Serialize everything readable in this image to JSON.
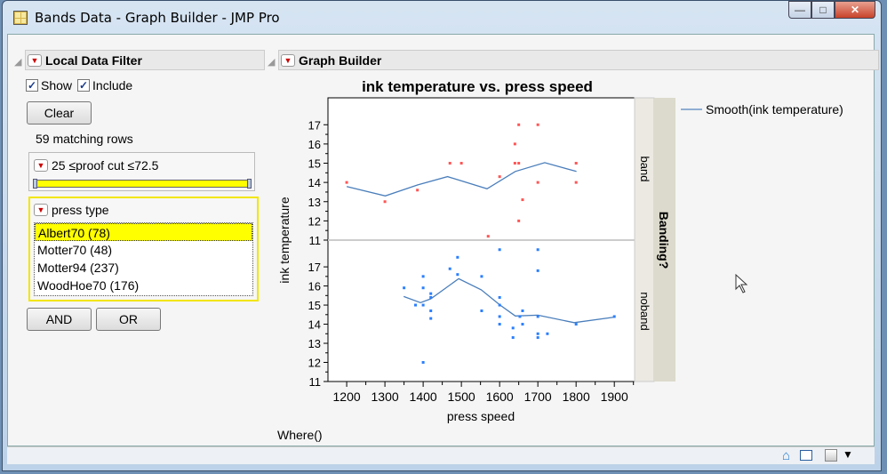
{
  "window": {
    "title": "Bands Data - Graph Builder - JMP Pro",
    "minimize": "—",
    "maximize": "□",
    "close": "✕"
  },
  "filter": {
    "header": "Local Data Filter",
    "show_label": "Show",
    "include_label": "Include",
    "show_checked": true,
    "include_checked": true,
    "clear": "Clear",
    "matching": "59 matching rows",
    "range": {
      "label": "25 ≤proof cut ≤72.5",
      "min": 25,
      "max": 72.5
    },
    "category": {
      "label": "press type",
      "items": [
        "Albert70 (78)",
        "Motter70 (48)",
        "Motter94 (237)",
        "WoodHoe70 (176)"
      ],
      "selected": "Albert70 (78)"
    },
    "and": "AND",
    "or": "OR",
    "highlight": "#ffff00"
  },
  "graph": {
    "header": "Graph Builder",
    "where": "Where()"
  },
  "chart_data": {
    "type": "scatter",
    "title": "ink temperature vs. press speed",
    "xlabel": "press speed",
    "ylabel": "ink temperature",
    "group_label": "Banding?",
    "xlim": [
      1151,
      1953
    ],
    "ylim": [
      11,
      18.4
    ],
    "xticks": [
      1200,
      1300,
      1400,
      1500,
      1600,
      1700,
      1800,
      1900
    ],
    "yticks": [
      11,
      12,
      13,
      14,
      15,
      16,
      17
    ],
    "legend": {
      "label": "Smooth(ink temperature)",
      "position": "top-right"
    },
    "line_color": "#4a7ebb",
    "panels": [
      {
        "name": "band",
        "color": "#ff5555",
        "points": [
          [
            1200,
            14
          ],
          [
            1300,
            13
          ],
          [
            1385,
            13.6
          ],
          [
            1470,
            15
          ],
          [
            1500,
            15
          ],
          [
            1570,
            11.2
          ],
          [
            1600,
            14.3
          ],
          [
            1640,
            16
          ],
          [
            1640,
            15
          ],
          [
            1650,
            15
          ],
          [
            1650,
            17
          ],
          [
            1660,
            13.1
          ],
          [
            1650,
            12
          ],
          [
            1700,
            17
          ],
          [
            1700,
            14
          ],
          [
            1800,
            15
          ],
          [
            1800,
            14
          ]
        ],
        "smooth": [
          [
            1200,
            13.79
          ],
          [
            1301,
            13.3
          ],
          [
            1386,
            13.87
          ],
          [
            1464,
            14.3
          ],
          [
            1567,
            13.67
          ],
          [
            1641,
            14.57
          ],
          [
            1718,
            15.03
          ],
          [
            1801,
            14.57
          ]
        ]
      },
      {
        "name": "noband",
        "color": "#2a7fff",
        "points": [
          [
            1350,
            15.9
          ],
          [
            1380,
            15
          ],
          [
            1400,
            15
          ],
          [
            1400,
            15.9
          ],
          [
            1400,
            16.5
          ],
          [
            1400,
            12
          ],
          [
            1420,
            15.6
          ],
          [
            1420,
            15.4
          ],
          [
            1420,
            14.7
          ],
          [
            1420,
            14.3
          ],
          [
            1470,
            16.9
          ],
          [
            1490,
            17.5
          ],
          [
            1490,
            16.6
          ],
          [
            1553,
            16.5
          ],
          [
            1553,
            14.7
          ],
          [
            1600,
            17.9
          ],
          [
            1600,
            15.4
          ],
          [
            1600,
            15
          ],
          [
            1600,
            14.4
          ],
          [
            1600,
            14
          ],
          [
            1635,
            13.8
          ],
          [
            1635,
            13.3
          ],
          [
            1653,
            14.4
          ],
          [
            1660,
            14.7
          ],
          [
            1660,
            14
          ],
          [
            1700,
            17.9
          ],
          [
            1700,
            16.8
          ],
          [
            1700,
            14.4
          ],
          [
            1700,
            13.5
          ],
          [
            1700,
            13.3
          ],
          [
            1725,
            13.5
          ],
          [
            1800,
            14
          ],
          [
            1900,
            14.4
          ]
        ],
        "smooth": [
          [
            1349,
            15.45
          ],
          [
            1393,
            15.13
          ],
          [
            1420,
            15.33
          ],
          [
            1493,
            16.38
          ],
          [
            1552,
            15.8
          ],
          [
            1600,
            15.02
          ],
          [
            1641,
            14.43
          ],
          [
            1700,
            14.47
          ],
          [
            1795,
            14.08
          ],
          [
            1900,
            14.37
          ]
        ]
      }
    ]
  }
}
